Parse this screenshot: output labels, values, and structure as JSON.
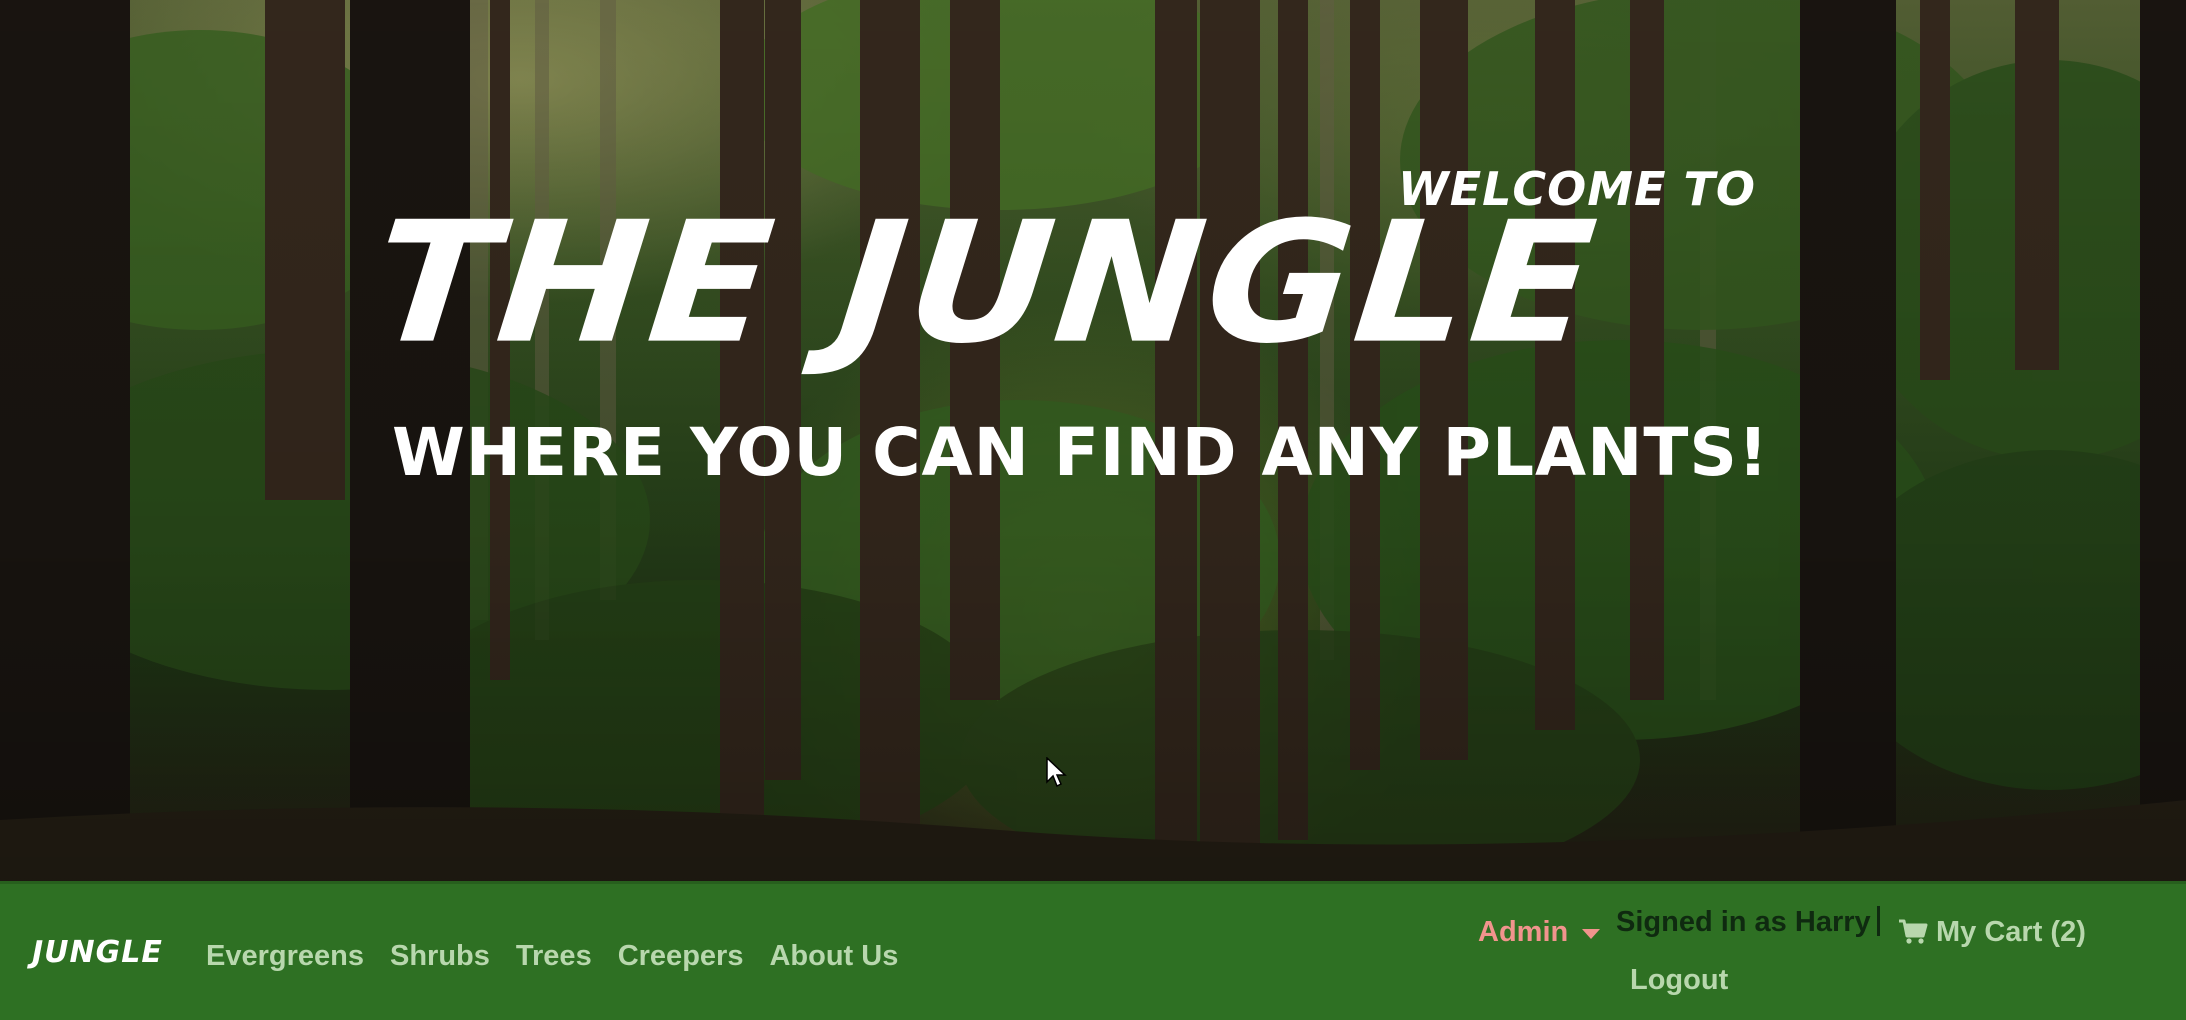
{
  "hero": {
    "welcome": "WELCOME TO",
    "title": "THE JUNGLE",
    "tagline": "WHERE YOU CAN FIND ANY PLANTS!"
  },
  "navbar": {
    "brand": "JUNGLE",
    "links": [
      "Evergreens",
      "Shrubs",
      "Trees",
      "Creepers",
      "About Us"
    ],
    "admin_label": "Admin",
    "signed_in": "Signed in as Harry",
    "cart_label": "My Cart (2)",
    "logout_label": "Logout"
  },
  "colors": {
    "navbar_bg": "#2e7023",
    "nav_link": "#b8d7ad",
    "admin": "#f1948d",
    "signed_in_text": "#0f2a10",
    "hero_text": "#ffffff"
  },
  "icons": {
    "cart": "shopping-cart-icon",
    "admin_dropdown": "caret-down-icon",
    "pointer": "mouse-cursor-icon"
  }
}
